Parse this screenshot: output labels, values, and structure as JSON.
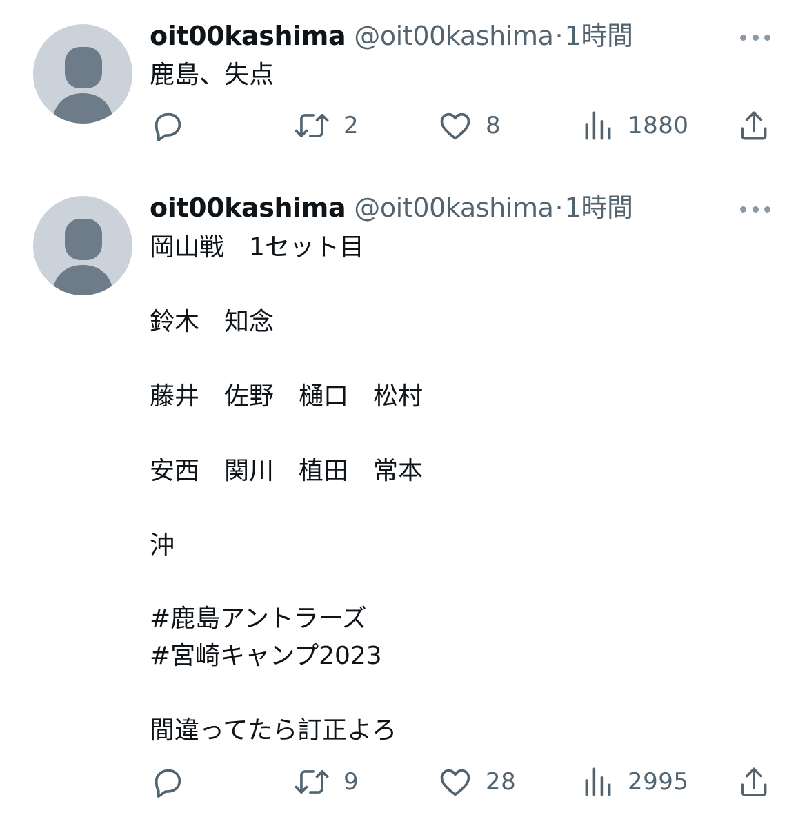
{
  "tweets": [
    {
      "username": "oit00kashima",
      "handle": "@oit00kashima",
      "separator": "·",
      "time": "1時間",
      "text": "鹿島、失点",
      "stats": {
        "replies": "",
        "retweets": "2",
        "likes": "8",
        "views": "1880"
      }
    },
    {
      "username": "oit00kashima",
      "handle": "@oit00kashima",
      "separator": "·",
      "time": "1時間",
      "lines": {
        "l1": "岡山戦　1セット目",
        "l2": "鈴木　知念",
        "l3": "藤井　佐野　樋口　松村",
        "l4": "安西　関川　植田　常本",
        "l5": "沖",
        "l8": "間違ってたら訂正よろ"
      },
      "hashtags": [
        "#鹿島アントラーズ",
        "#宮崎キャンプ2023"
      ],
      "stats": {
        "replies": "",
        "retweets": "9",
        "likes": "28",
        "views": "2995"
      }
    }
  ],
  "icons": [
    "reply-icon",
    "retweet-icon",
    "like-icon",
    "views-icon",
    "share-icon",
    "more-icon",
    "avatar-icon"
  ],
  "colors": {
    "text": "#0f1419",
    "secondary": "#536471",
    "hashtag": "#3d8fd6",
    "avatar_bg": "#cbd2d9",
    "avatar_fg": "#6e7b88"
  }
}
